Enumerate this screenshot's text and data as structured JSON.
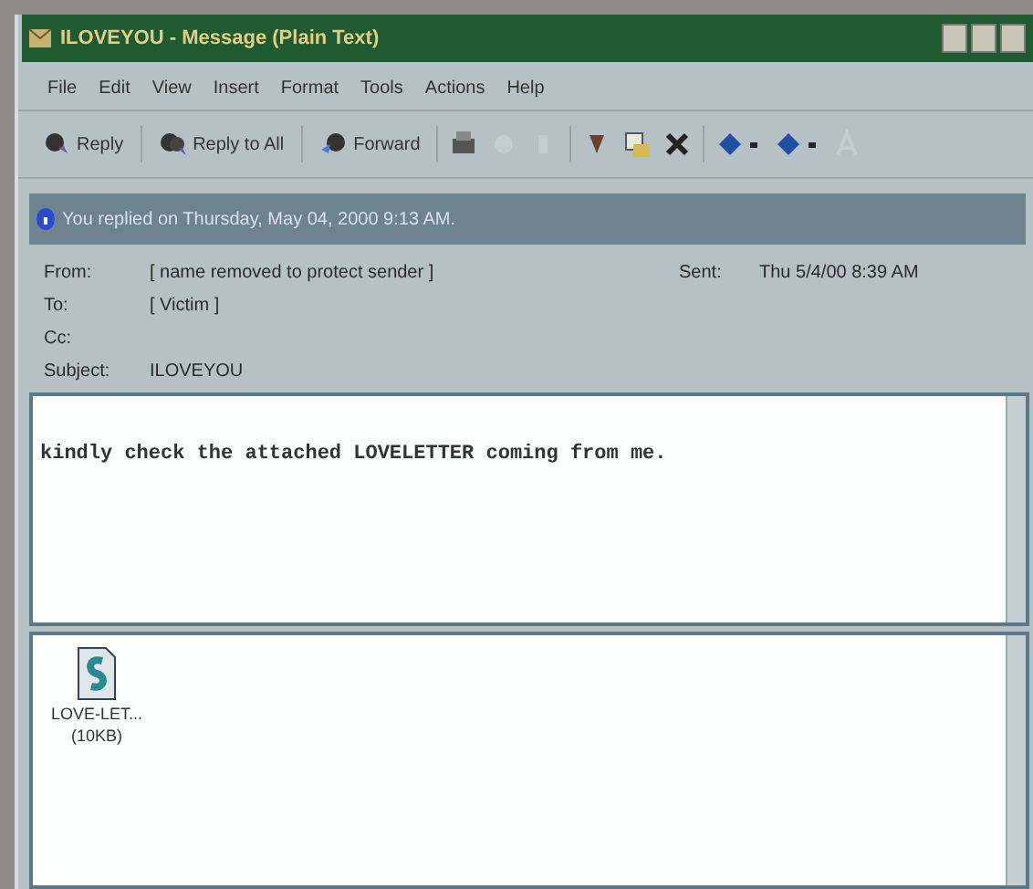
{
  "window": {
    "title": "ILOVEYOU - Message (Plain Text)"
  },
  "menu": [
    "File",
    "Edit",
    "View",
    "Insert",
    "Format",
    "Tools",
    "Actions",
    "Help"
  ],
  "toolbar": [
    {
      "kind": "reply",
      "label": "Reply"
    },
    {
      "kind": "reply-all",
      "label": "Reply to All"
    },
    {
      "kind": "forward",
      "label": "Forward"
    }
  ],
  "info_bar": "You replied on Thursday, May 04, 2000 9:13 AM.",
  "headers": [
    {
      "label": "From:",
      "value": "[ name removed to protect sender ]"
    },
    {
      "label": "To:",
      "value": "[ Victim ]"
    },
    {
      "label": "Cc:"
    },
    {
      "label": "Subject:",
      "value": "ILOVEYOU"
    }
  ],
  "sent": {
    "label": "Sent:",
    "value": "Thu 5/4/00 8:39 AM"
  },
  "body": "kindly check the attached LOVELETTER coming from me.",
  "attachments": [
    {
      "name": "LOVE-LET...",
      "size": "(10KB)"
    }
  ]
}
